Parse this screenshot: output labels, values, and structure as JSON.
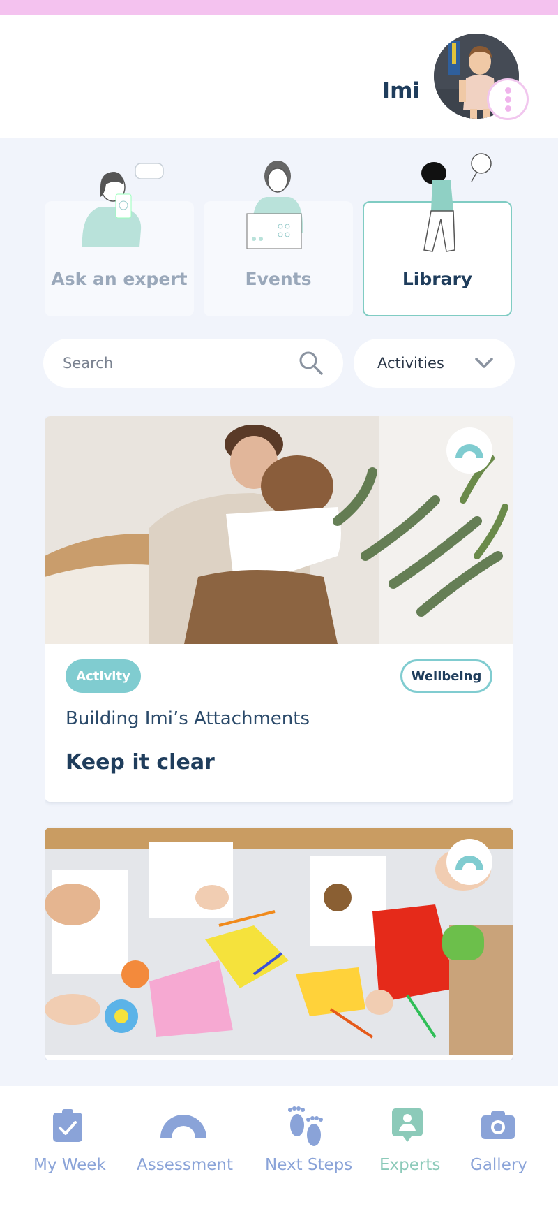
{
  "header": {
    "child_name": "Imi"
  },
  "tabs": [
    {
      "label": "Ask an expert",
      "active": false
    },
    {
      "label": "Events",
      "active": false
    },
    {
      "label": "Library",
      "active": true
    }
  ],
  "search": {
    "placeholder": "Search"
  },
  "filter": {
    "selected": "Activities"
  },
  "posts": [
    {
      "type_tag": "Activity",
      "topic_tag": "Wellbeing",
      "subtitle": "Building Imi’s Attachments",
      "title": "Keep it clear"
    },
    {
      "type_tag": "",
      "topic_tag": "",
      "subtitle": "",
      "title": ""
    }
  ],
  "bottom_nav": [
    {
      "label": "My Week",
      "icon": "clipboard-check-icon",
      "active": false
    },
    {
      "label": "Assessment",
      "icon": "half-circle-icon",
      "active": false
    },
    {
      "label": "Next Steps",
      "icon": "footprints-icon",
      "active": false
    },
    {
      "label": "Experts",
      "icon": "expert-badge-icon",
      "active": true
    },
    {
      "label": "Gallery",
      "icon": "camera-icon",
      "active": false
    }
  ],
  "colors": {
    "accent_pink": "#f4c2ef",
    "accent_teal": "#80ccd0",
    "navy": "#1f3d5c",
    "nav_blue": "#8aa3d8",
    "nav_active": "#8ccab9"
  }
}
